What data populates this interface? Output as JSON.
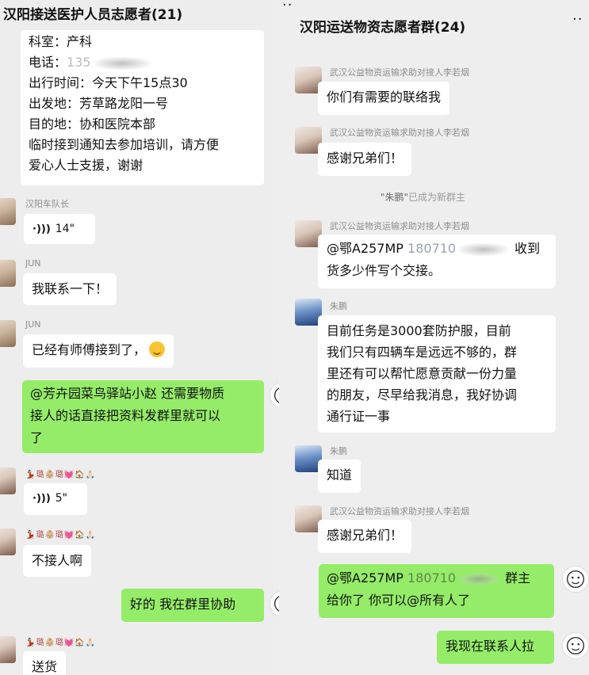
{
  "left": {
    "title": "汉阳接送医护人员志愿者(21)",
    "msg1": {
      "lines": [
        "科室：产科",
        "电话：",
        "出行时间：今天下午15点30",
        "出发地：芳草路龙阳一号",
        "目的地：协和医院本部",
        "临时接到通知去参加培训，请方便",
        "爱心人士支援，谢谢"
      ],
      "phone_visible": "135"
    },
    "msg2": {
      "sender": "汉阳车队长",
      "duration": "14\""
    },
    "msg3": {
      "sender": "JUN",
      "text": "我联系一下！"
    },
    "msg4": {
      "sender": "JUN",
      "text": "已经有师傅接到了，"
    },
    "msg5": {
      "lines": [
        "@芳卉园菜鸟驿站小赵  还需要物质",
        "接人的话直接把资料发群里就可以",
        "了"
      ]
    },
    "msg6": {
      "sender": "💃🏻璐👶🏼璐💓🏠🙏🏻",
      "duration": "5\""
    },
    "msg7": {
      "sender": "💃🏻璐👶🏼璐💓🏠🙏🏻",
      "text": "不接人啊"
    },
    "msg8": {
      "text": "好的  我在群里协助"
    },
    "msg9": {
      "sender": "💃🏻璐👶🏼璐💓🏠🙏🏻",
      "text": "送货"
    }
  },
  "right": {
    "title": "汉阳运送物资志愿者群(24)",
    "msg1": {
      "sender": "武汉公益物资运输求助对接人李若烟",
      "text": "你们有需要的联络我"
    },
    "msg2": {
      "sender": "武汉公益物资运输求助对接人李若烟",
      "text": "感谢兄弟们！"
    },
    "system": {
      "name": "\"朱鹏\"",
      "suffix": "已成为新群主"
    },
    "msg3": {
      "sender": "武汉公益物资运输求助对接人李若烟",
      "line1_prefix": "@鄂A257MP ",
      "line1_phone": "180710",
      "line1_suffix": "收到",
      "line2": "货多少件写个交接。"
    },
    "msg4": {
      "sender": "朱鹏",
      "lines": [
        "目前任务是3000套防护服，目前",
        "我们只有四辆车是远远不够的，群",
        "里还有可以帮忙愿意贡献一份力量",
        "的朋友，尽早给我消息，我好协调",
        "通行证一事"
      ]
    },
    "msg5": {
      "sender": "朱鹏",
      "text": "知道"
    },
    "msg6": {
      "sender": "武汉公益物资运输求助对接人李若烟",
      "text": "感谢兄弟们！"
    },
    "msg7": {
      "line1_prefix": "@鄂A257MP ",
      "line1_phone": "180710",
      "line1_suffix": "群主",
      "line2": "给你了  你可以@所有人了"
    },
    "msg8": {
      "text": "我现在联系人拉"
    }
  },
  "colors": {
    "self_bubble": "#95ec69",
    "other_bubble": "#ffffff",
    "background": "#ededed",
    "system_text": "#9a9a9a"
  }
}
